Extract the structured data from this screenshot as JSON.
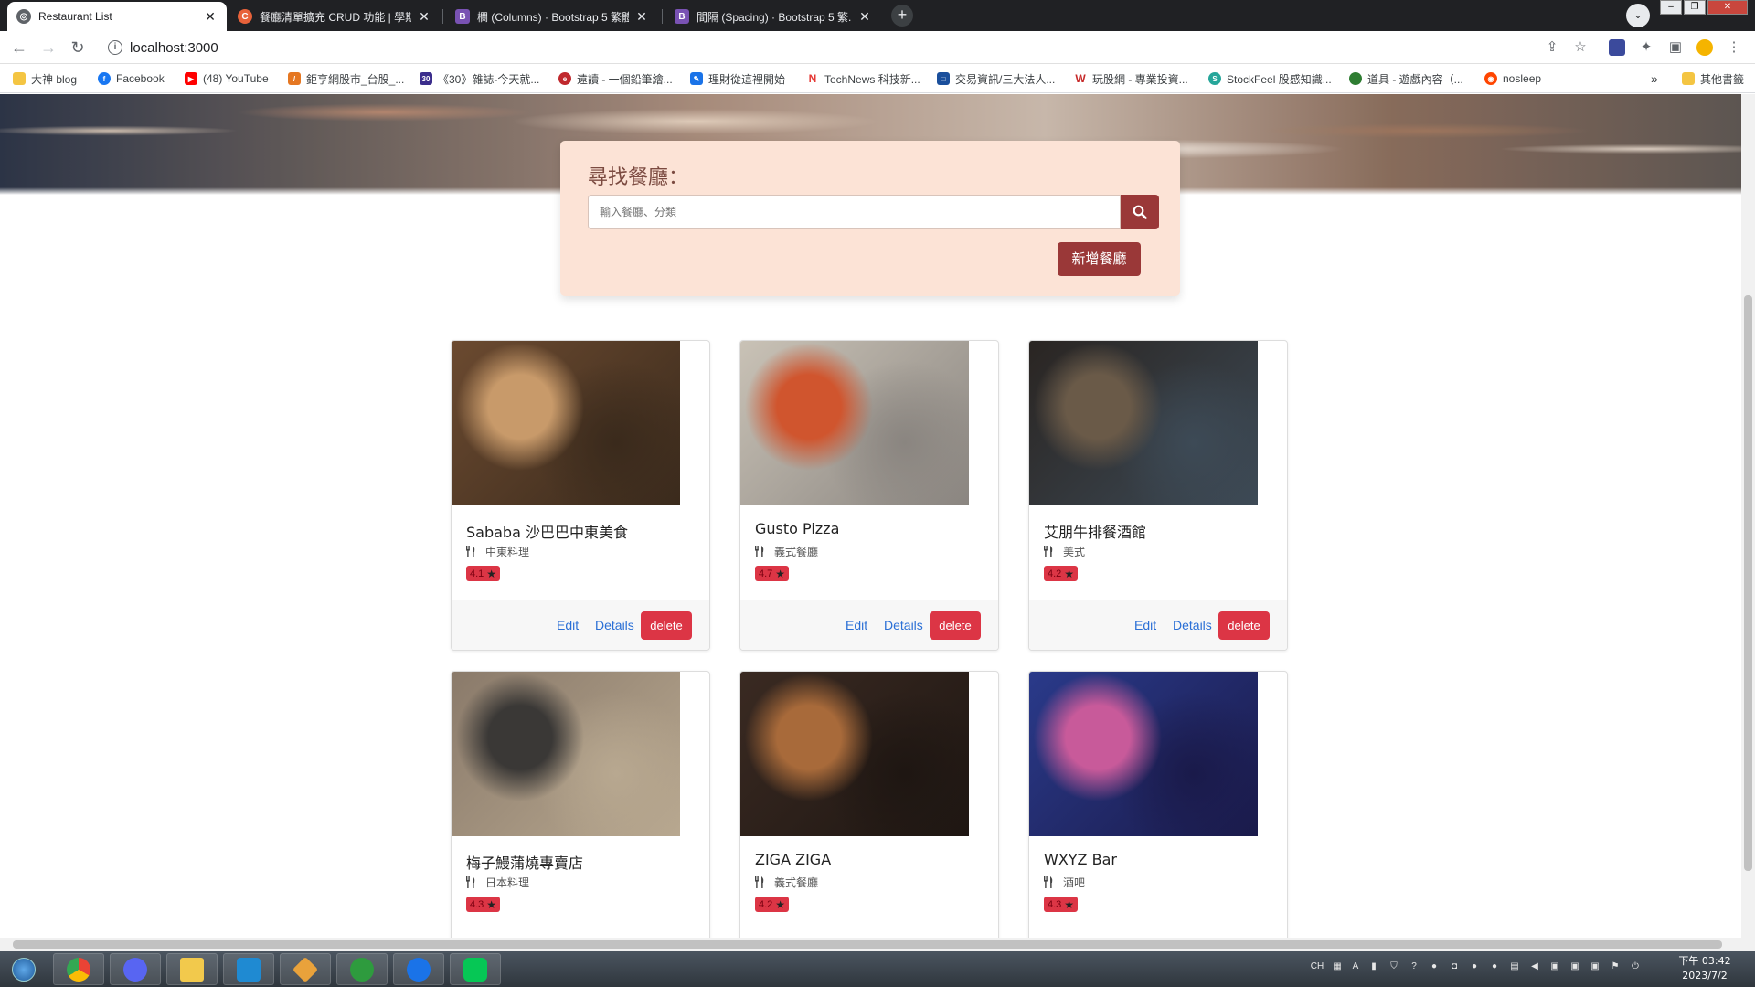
{
  "browser": {
    "tabs": [
      {
        "label": "Restaurant List",
        "active": true,
        "icon": "globe-icon",
        "color": "#5f6368"
      },
      {
        "label": "餐廳清單擴充 CRUD 功能 | 學期...",
        "active": false,
        "icon": "alphacamp-icon",
        "color": "#e8623a"
      },
      {
        "label": "欄 (Columns) · Bootstrap 5 繁體...",
        "active": false,
        "icon": "bootstrap-icon",
        "color": "#7952b3"
      },
      {
        "label": "間隔 (Spacing) · Bootstrap 5 繁...",
        "active": false,
        "icon": "bootstrap-icon",
        "color": "#7952b3"
      }
    ],
    "new_tab": "+",
    "url": "localhost:3000",
    "bookmarks": [
      {
        "label": "大神 blog",
        "icon": "folder-icon",
        "color": "#f4c542"
      },
      {
        "label": "Facebook",
        "icon": "facebook-icon",
        "color": "#1877f2"
      },
      {
        "label": "(48) YouTube",
        "icon": "youtube-icon",
        "color": "#ff0000"
      },
      {
        "label": "鉅亨網股市_台股_...",
        "icon": "cnyes-icon",
        "color": "#e57722"
      },
      {
        "label": "《30》雜誌-今天就...",
        "icon": "magazine30-icon",
        "color": "#3b2d8c"
      },
      {
        "label": "遠讀 - 一個鉛筆繪...",
        "icon": "readmoo-icon",
        "color": "#c0282d"
      },
      {
        "label": "理財從這裡開始",
        "icon": "pen-icon",
        "color": "#1a73e8"
      },
      {
        "label": "TechNews 科技新...",
        "icon": "technews-icon",
        "color": "#e53935"
      },
      {
        "label": "交易資訊/三大法人...",
        "icon": "twse-icon",
        "color": "#1a4f9c"
      },
      {
        "label": "玩股網 - 專業投資...",
        "icon": "wantgoo-icon",
        "color": "#c62828"
      },
      {
        "label": "StockFeel 股感知識...",
        "icon": "stockfeel-icon",
        "color": "#26a69a"
      },
      {
        "label": "道具 - 遊戲內容（...",
        "icon": "game-icon",
        "color": "#2e7d32"
      },
      {
        "label": "nosleep",
        "icon": "reddit-icon",
        "color": "#ff4500"
      }
    ],
    "more_bookmarks": "»",
    "other_bookmarks": "其他書籤"
  },
  "page": {
    "search": {
      "title": "尋找餐廳：",
      "placeholder": "輸入餐廳、分類",
      "add_label": "新增餐廳"
    },
    "cards": [
      {
        "name": "Sababa 沙巴巴中東美食",
        "category": "中東料理",
        "rating": "4.1",
        "image_colors": [
          "#6b4a30",
          "#c89a6a",
          "#3a2a1c"
        ]
      },
      {
        "name": "Gusto Pizza",
        "category": "義式餐廳",
        "rating": "4.7",
        "image_colors": [
          "#c9c2b6",
          "#d0552e",
          "#8a8580"
        ]
      },
      {
        "name": "艾朋牛排餐酒館",
        "category": "美式",
        "rating": "4.2",
        "image_colors": [
          "#2a2522",
          "#6a5a48",
          "#3d4a56"
        ]
      },
      {
        "name": "梅子鰻蒲燒專賣店",
        "category": "日本料理",
        "rating": "4.3",
        "image_colors": [
          "#8a7a6a",
          "#3a3836",
          "#b8a890"
        ]
      },
      {
        "name": "ZIGA ZIGA",
        "category": "義式餐廳",
        "rating": "4.2",
        "image_colors": [
          "#3a2a22",
          "#a86a3a",
          "#1e1612"
        ]
      },
      {
        "name": "WXYZ Bar",
        "category": "酒吧",
        "rating": "4.3",
        "image_colors": [
          "#2a3a8a",
          "#c85a9a",
          "#1a1a4a"
        ]
      }
    ],
    "edit_label": "Edit",
    "details_label": "Details",
    "delete_label": "delete"
  },
  "taskbar": {
    "apps": [
      "windows-start-icon",
      "chrome-icon",
      "discord-icon",
      "file-explorer-icon",
      "vscode-icon",
      "sourcetree-icon",
      "gitkraken-icon",
      "maps-icon",
      "line-icon"
    ],
    "lang": "CH",
    "time": "下午 03:42",
    "date": "2023/7/2"
  }
}
